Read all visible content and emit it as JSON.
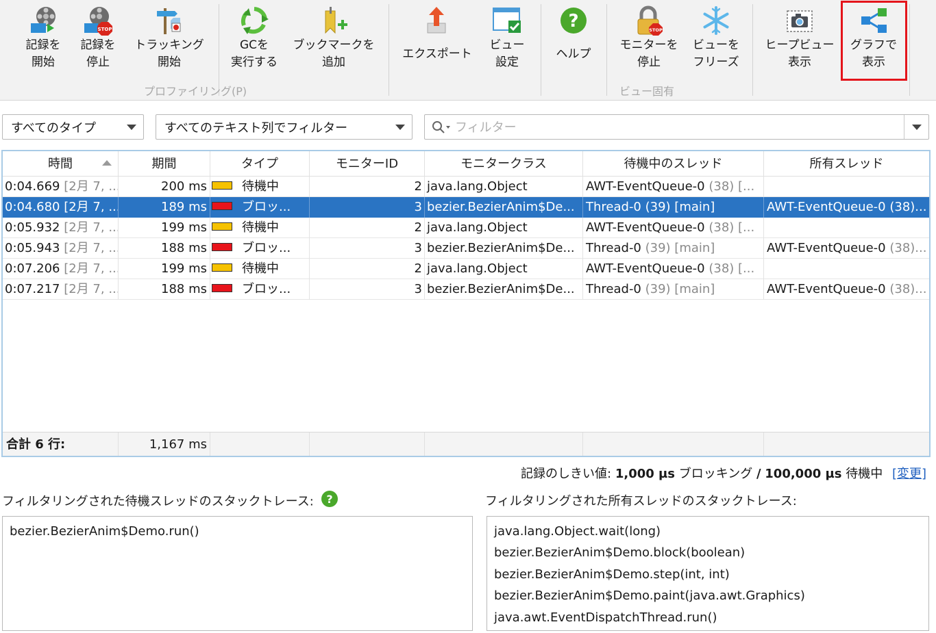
{
  "toolbar": {
    "buttons": [
      {
        "id": "start-recording",
        "line1": "記録を",
        "line2": "開始",
        "icon": "film-reel-play-icon"
      },
      {
        "id": "stop-recording",
        "line1": "記録を",
        "line2": "停止",
        "icon": "film-reel-stop-icon"
      },
      {
        "id": "start-tracking",
        "line1": "トラッキング",
        "line2": "開始",
        "icon": "tracking-signpost-icon"
      },
      {
        "id": "run-gc",
        "line1": "GCを",
        "line2": "実行する",
        "icon": "recycle-icon"
      },
      {
        "id": "add-bookmark",
        "line1": "ブックマークを",
        "line2": "追加",
        "icon": "bookmark-add-icon"
      },
      {
        "id": "export",
        "line1": "エクスポート",
        "line2": "",
        "icon": "export-arrow-icon"
      },
      {
        "id": "view-settings",
        "line1": "ビュー",
        "line2": "設定",
        "icon": "view-settings-check-icon"
      },
      {
        "id": "help",
        "line1": "ヘルプ",
        "line2": "",
        "icon": "help-question-icon"
      },
      {
        "id": "stop-monitors",
        "line1": "モニターを",
        "line2": "停止",
        "icon": "lock-stop-icon"
      },
      {
        "id": "freeze-view",
        "line1": "ビューを",
        "line2": "フリーズ",
        "icon": "snowflake-icon"
      },
      {
        "id": "show-heap-view",
        "line1": "ヒープビュー",
        "line2": "表示",
        "icon": "camera-icon"
      },
      {
        "id": "show-graph",
        "line1": "グラフで",
        "line2": "表示",
        "icon": "graph-nodes-icon"
      }
    ],
    "group_profiling": "プロファイリング(P)",
    "group_view_specific": "ビュー固有"
  },
  "filters": {
    "type_select": "すべてのタイプ",
    "text_column_select": "すべてのテキスト列でフィルター",
    "search_placeholder": "フィルター"
  },
  "table": {
    "columns": [
      "時間",
      "期間",
      "タイプ",
      "モニターID",
      "モニタークラス",
      "待機中のスレッド",
      "所有スレッド"
    ],
    "rows": [
      {
        "time": "0:04.669",
        "time_date": "[2月 7, ...",
        "duration": "200 ms",
        "type": "待機中",
        "type_color": "#f6c200",
        "monitor_id": "2",
        "monitor_class": "java.lang.Object",
        "waiting_thread": "AWT-EventQueue-0",
        "waiting_thread_detail": "(38) [...",
        "owning_thread": "",
        "owning_thread_detail": "",
        "selected": false
      },
      {
        "time": "0:04.680",
        "time_date": "[2月 7, ...",
        "duration": "189 ms",
        "type": "ブロッ...",
        "type_color": "#e8141b",
        "monitor_id": "3",
        "monitor_class": "bezier.BezierAnim$De...",
        "waiting_thread": "Thread-0",
        "waiting_thread_detail": "(39) [main]",
        "owning_thread": "AWT-EventQueue-0",
        "owning_thread_detail": "(38)...",
        "selected": true
      },
      {
        "time": "0:05.932",
        "time_date": "[2月 7, ...",
        "duration": "199 ms",
        "type": "待機中",
        "type_color": "#f6c200",
        "monitor_id": "2",
        "monitor_class": "java.lang.Object",
        "waiting_thread": "AWT-EventQueue-0",
        "waiting_thread_detail": "(38) [...",
        "owning_thread": "",
        "owning_thread_detail": "",
        "selected": false
      },
      {
        "time": "0:05.943",
        "time_date": "[2月 7, ...",
        "duration": "188 ms",
        "type": "ブロッ...",
        "type_color": "#e8141b",
        "monitor_id": "3",
        "monitor_class": "bezier.BezierAnim$De...",
        "waiting_thread": "Thread-0",
        "waiting_thread_detail": "(39) [main]",
        "owning_thread": "AWT-EventQueue-0",
        "owning_thread_detail": "(38)...",
        "selected": false
      },
      {
        "time": "0:07.206",
        "time_date": "[2月 7, ...",
        "duration": "199 ms",
        "type": "待機中",
        "type_color": "#f6c200",
        "monitor_id": "2",
        "monitor_class": "java.lang.Object",
        "waiting_thread": "AWT-EventQueue-0",
        "waiting_thread_detail": "(38) [...",
        "owning_thread": "",
        "owning_thread_detail": "",
        "selected": false
      },
      {
        "time": "0:07.217",
        "time_date": "[2月 7, ...",
        "duration": "188 ms",
        "type": "ブロッ...",
        "type_color": "#e8141b",
        "monitor_id": "3",
        "monitor_class": "bezier.BezierAnim$De...",
        "waiting_thread": "Thread-0",
        "waiting_thread_detail": "(39) [main]",
        "owning_thread": "AWT-EventQueue-0",
        "owning_thread_detail": "(38)...",
        "selected": false
      }
    ],
    "footer": {
      "label": "合計 6 行:",
      "total": "1,167 ms"
    }
  },
  "threshold": {
    "prefix": "記録のしきい値:",
    "blocking_value": "1,000 µs",
    "blocking_label": "ブロッキング",
    "slash": "/",
    "waiting_value": "100,000 µs",
    "waiting_label": "待機中",
    "change_link": "[変更]"
  },
  "stacks": {
    "waiting_label": "フィルタリングされた待機スレッドのスタックトレース:",
    "owning_label": "フィルタリングされた所有スレッドのスタックトレース:",
    "waiting_lines": [
      "bezier.BezierAnim$Demo.run()"
    ],
    "owning_lines": [
      "java.lang.Object.wait(long)",
      "bezier.BezierAnim$Demo.block(boolean)",
      "bezier.BezierAnim$Demo.step(int, int)",
      "bezier.BezierAnim$Demo.paint(java.awt.Graphics)",
      "java.awt.EventDispatchThread.run()"
    ]
  },
  "colors": {
    "accent": "#2a74c3",
    "highlight_box": "#e4141b",
    "waiting": "#f6c200",
    "blocking": "#e8141b",
    "help_green": "#4aa82b"
  }
}
